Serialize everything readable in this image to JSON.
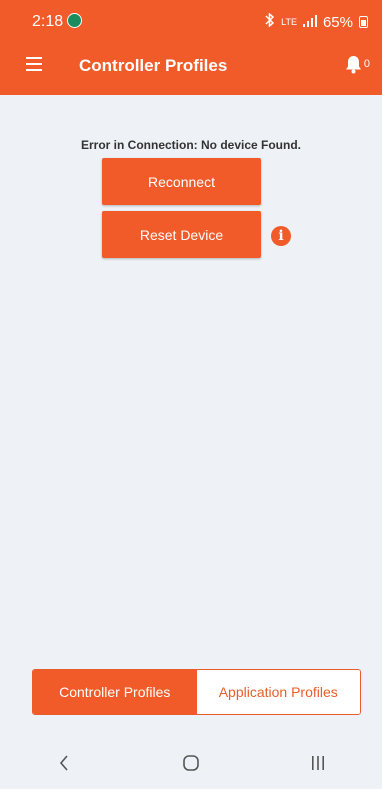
{
  "status_bar": {
    "time": "2:18",
    "network_label": "LTE",
    "battery": "65%"
  },
  "app_bar": {
    "title": "Controller Profiles",
    "notification_count": "0"
  },
  "main": {
    "error_message": "Error in Connection: No device Found.",
    "reconnect_label": "Reconnect",
    "reset_label": "Reset Device"
  },
  "tabs": {
    "controller": "Controller Profiles",
    "application": "Application Profiles"
  },
  "colors": {
    "accent": "#f15a29",
    "background": "#eef2f6"
  },
  "icons": [
    "menu-icon",
    "bell-icon",
    "info-icon",
    "back-icon",
    "home-icon",
    "recents-icon"
  ]
}
